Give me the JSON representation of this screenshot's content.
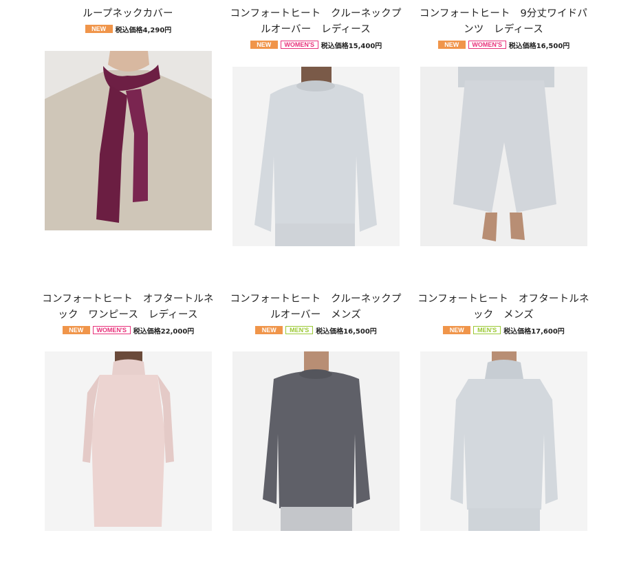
{
  "products": [
    {
      "title": "ループネックカバー",
      "badges": {
        "new": "NEW"
      },
      "price": "税込価格4,290円",
      "image": "scarf-on-beige-sweater"
    },
    {
      "title": "コンフォートヒート　クルーネックプルオーバー　レディース",
      "badges": {
        "new": "NEW",
        "gender": "WOMEN'S"
      },
      "price": "税込価格15,400円",
      "image": "light-grey-crewneck-womens"
    },
    {
      "title": "コンフォートヒート　9分丈ワイドパンツ　レディース",
      "badges": {
        "new": "NEW",
        "gender": "WOMEN'S"
      },
      "price": "税込価格16,500円",
      "image": "grey-wide-pants"
    },
    {
      "title": "コンフォートヒート　オフタートルネック　ワンピース　レディース",
      "badges": {
        "new": "NEW",
        "gender": "WOMEN'S"
      },
      "price": "税込価格22,000円",
      "image": "pink-turtleneck-dress"
    },
    {
      "title": "コンフォートヒート　クルーネックプルオーバー　メンズ",
      "badges": {
        "new": "NEW",
        "gender": "MEN'S"
      },
      "price": "税込価格16,500円",
      "image": "charcoal-crewneck-mens"
    },
    {
      "title": "コンフォートヒート　オフタートルネック　メンズ",
      "badges": {
        "new": "NEW",
        "gender": "MEN'S"
      },
      "price": "税込価格17,600円",
      "image": "light-grey-turtleneck-mens"
    }
  ],
  "colors": {
    "new_badge": "#f0954a",
    "womens_badge": "#e8307a",
    "mens_badge": "#9bc934"
  }
}
